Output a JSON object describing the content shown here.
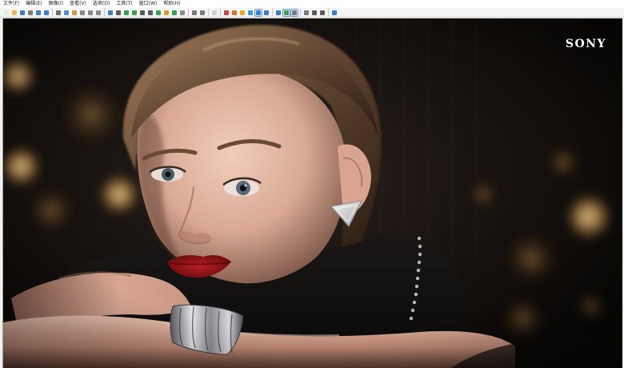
{
  "menu": {
    "items": [
      {
        "label": "文件(F)"
      },
      {
        "label": "编辑(E)"
      },
      {
        "label": "图像(I)"
      },
      {
        "label": "查看(V)"
      },
      {
        "label": "选项(O)"
      },
      {
        "label": "工具(T)"
      },
      {
        "label": "窗口(W)"
      },
      {
        "label": "帮助(H)"
      }
    ]
  },
  "toolbar": {
    "groups": [
      [
        {
          "icon": "new-file-icon",
          "color": "#e9e9e9"
        },
        {
          "icon": "open-folder-icon",
          "color": "#e8b84a"
        },
        {
          "icon": "save-icon",
          "color": "#4a78c8"
        },
        {
          "icon": "print-icon",
          "color": "#7a7a7a"
        },
        {
          "icon": "previous-arrow-icon",
          "color": "#3a7ad8"
        },
        {
          "icon": "next-arrow-icon",
          "color": "#3a7ad8"
        }
      ],
      [
        {
          "icon": "cut-icon",
          "color": "#6b6b6b"
        },
        {
          "icon": "copy-icon",
          "color": "#5a88c8"
        },
        {
          "icon": "paste-icon",
          "color": "#c89a4a"
        },
        {
          "icon": "undo-icon",
          "color": "#8a8a8a"
        },
        {
          "icon": "redo-icon",
          "color": "#8a8a8a"
        },
        {
          "icon": "delete-icon",
          "color": "#8a8a8a"
        }
      ],
      [
        {
          "icon": "info-icon",
          "color": "#4a78c8"
        },
        {
          "icon": "camera-icon",
          "color": "#5a5a5a"
        },
        {
          "icon": "resize-icon",
          "color": "#3aa050"
        },
        {
          "icon": "crop-icon",
          "color": "#3aa050"
        },
        {
          "icon": "rotate-left-icon",
          "color": "#5a5a5a"
        },
        {
          "icon": "rotate-right-icon",
          "color": "#5a5a5a"
        },
        {
          "icon": "enhance-icon",
          "color": "#3aa050"
        },
        {
          "icon": "color-adjust-icon",
          "color": "#d8a030"
        },
        {
          "icon": "effects-icon",
          "color": "#3aa050"
        },
        {
          "icon": "settings-icon",
          "color": "#8a8a8a"
        }
      ],
      [
        {
          "icon": "zoom-in-icon",
          "color": "#7a7a7a"
        },
        {
          "icon": "zoom-out-icon",
          "color": "#7a7a7a"
        }
      ],
      [
        {
          "icon": "page-icon",
          "color": "#d0d0d0"
        }
      ],
      [
        {
          "icon": "flag-red-icon",
          "color": "#d84040"
        },
        {
          "icon": "flag-orange-icon",
          "color": "#e07030"
        },
        {
          "icon": "star-icon",
          "color": "#e0b020"
        },
        {
          "icon": "thumbnails-icon",
          "color": "#3a9ad8"
        },
        {
          "icon": "fit-window-icon",
          "color": "#3a7ad8",
          "active": true
        },
        {
          "icon": "full-screen-icon",
          "color": "#3a7ad8"
        }
      ],
      [
        {
          "icon": "slideshow-icon",
          "color": "#3a7ad8"
        },
        {
          "icon": "grid-icon",
          "color": "#3aa050",
          "active": true
        },
        {
          "icon": "compare-icon",
          "color": "#7a7a7a",
          "active": true
        }
      ],
      [
        {
          "icon": "wrench-icon",
          "color": "#7a7a7a"
        },
        {
          "icon": "search-icon",
          "color": "#5a5a5a"
        },
        {
          "icon": "batch-icon",
          "color": "#5a5a5a"
        }
      ],
      [
        {
          "icon": "help-icon",
          "color": "#3a7ad8"
        }
      ]
    ]
  },
  "image": {
    "brand_text": "SONY",
    "description_icon": "portrait-photo-icon"
  }
}
